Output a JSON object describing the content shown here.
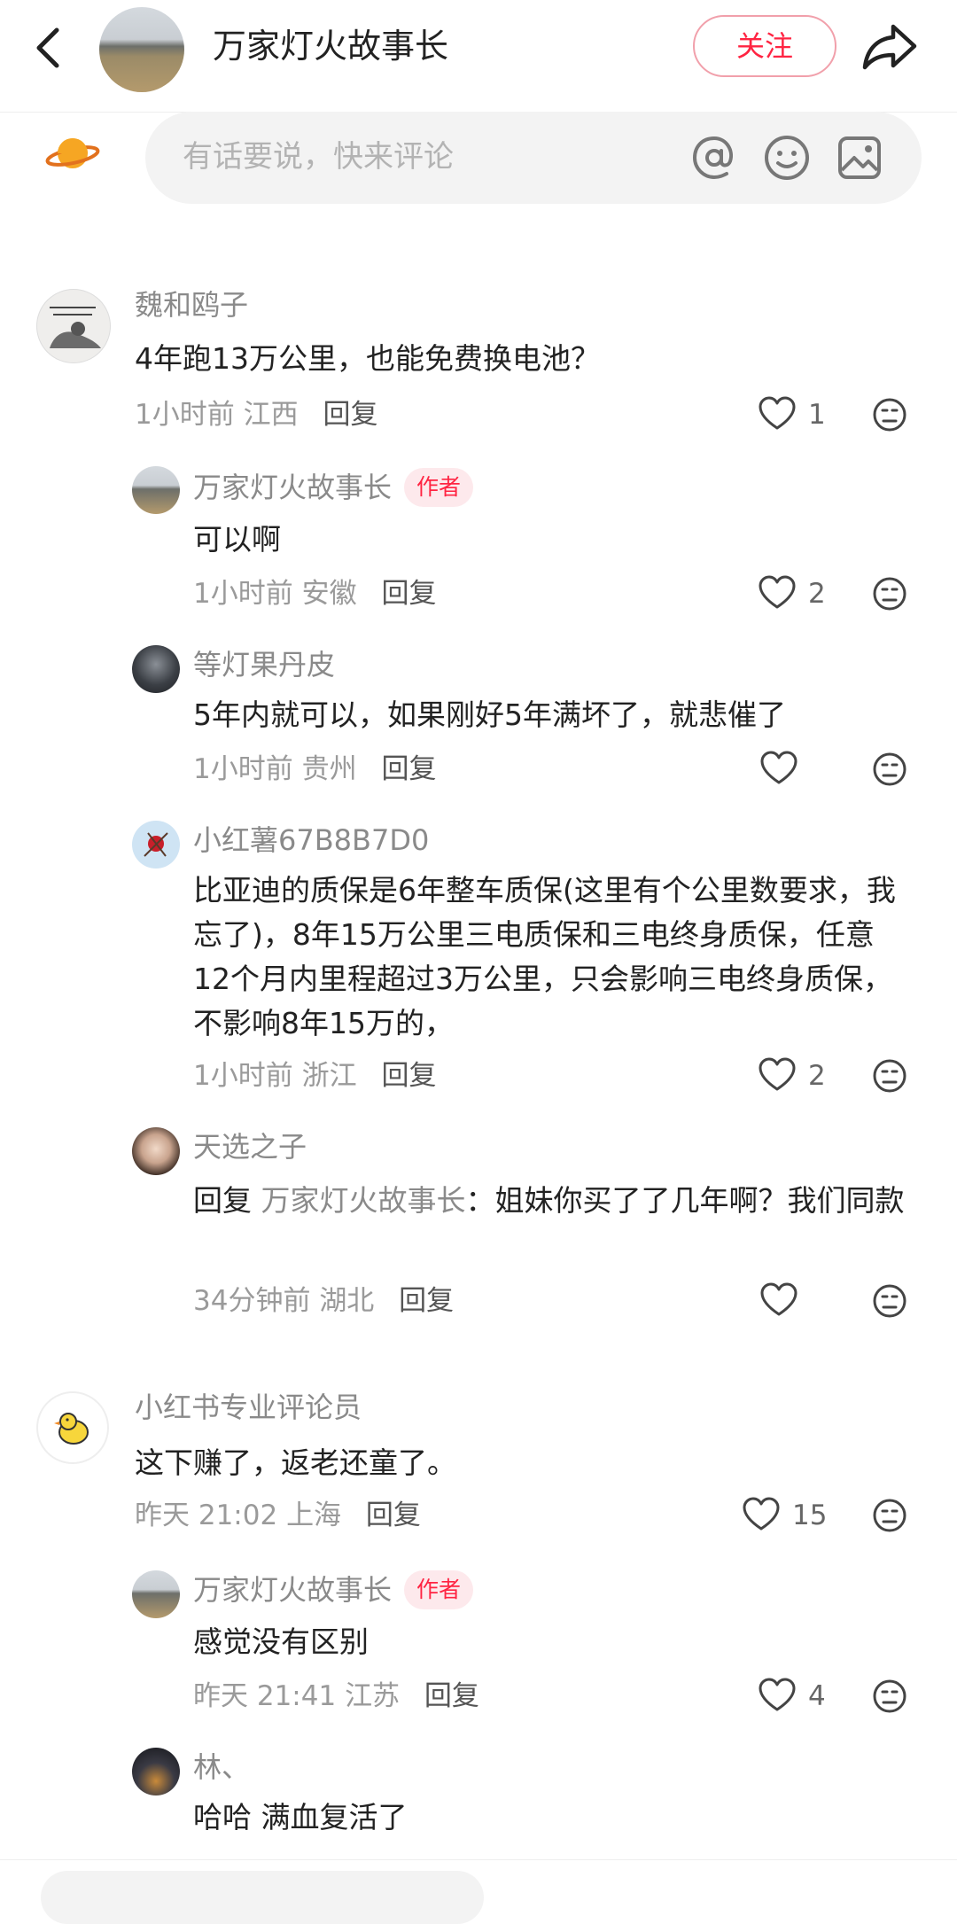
{
  "header": {
    "author_name": "万家灯火故事长",
    "follow_label": "关注"
  },
  "comment_box": {
    "placeholder": "有话要说，快来评论"
  },
  "author_badge": "作者",
  "reply_label": "回复",
  "comments": [
    {
      "name": "魏和鸥子",
      "text": "4年跑13万公里，也能免费换电池？",
      "time": "1小时前",
      "location": "江西",
      "likes": "1",
      "replies": [
        {
          "name": "万家灯火故事长",
          "is_author": true,
          "text": "可以啊",
          "time": "1小时前",
          "location": "安徽",
          "likes": "2"
        },
        {
          "name": "等灯果丹皮",
          "is_author": false,
          "text": "5年内就可以，如果刚好5年满坏了，就悲催了",
          "time": "1小时前",
          "location": "贵州",
          "likes": ""
        },
        {
          "name": "小红薯67B8B7D0",
          "is_author": false,
          "text": "比亚迪的质保是6年整车质保(这里有个公里数要求，我忘了)，8年15万公里三电质保和三电终身质保，任意12个月内里程超过3万公里，只会影响三电终身质保，不影响8年15万的，",
          "time": "1小时前",
          "location": "浙江",
          "likes": "2"
        },
        {
          "name": "天选之子",
          "is_author": false,
          "reply_prefix": "回复",
          "reply_target": "万家灯火故事长",
          "text": "：姐妹你买了了几年啊？我们同款",
          "time": "34分钟前",
          "location": "湖北",
          "likes": ""
        }
      ]
    },
    {
      "name": "小红书专业评论员",
      "text": "这下赚了，返老还童了。",
      "time": "昨天 21:02",
      "location": "上海",
      "likes": "15",
      "replies": [
        {
          "name": "万家灯火故事长",
          "is_author": true,
          "text": "感觉没有区别",
          "time": "昨天 21:41",
          "location": "江苏",
          "likes": "4"
        },
        {
          "name": "林、",
          "is_author": false,
          "text": "哈哈 满血复活了",
          "time": "",
          "location": "",
          "likes": ""
        }
      ]
    }
  ],
  "colors": {
    "accent": "#ff2442",
    "badge_bg": "#fde9ec",
    "meta": "#9a9a9a"
  }
}
